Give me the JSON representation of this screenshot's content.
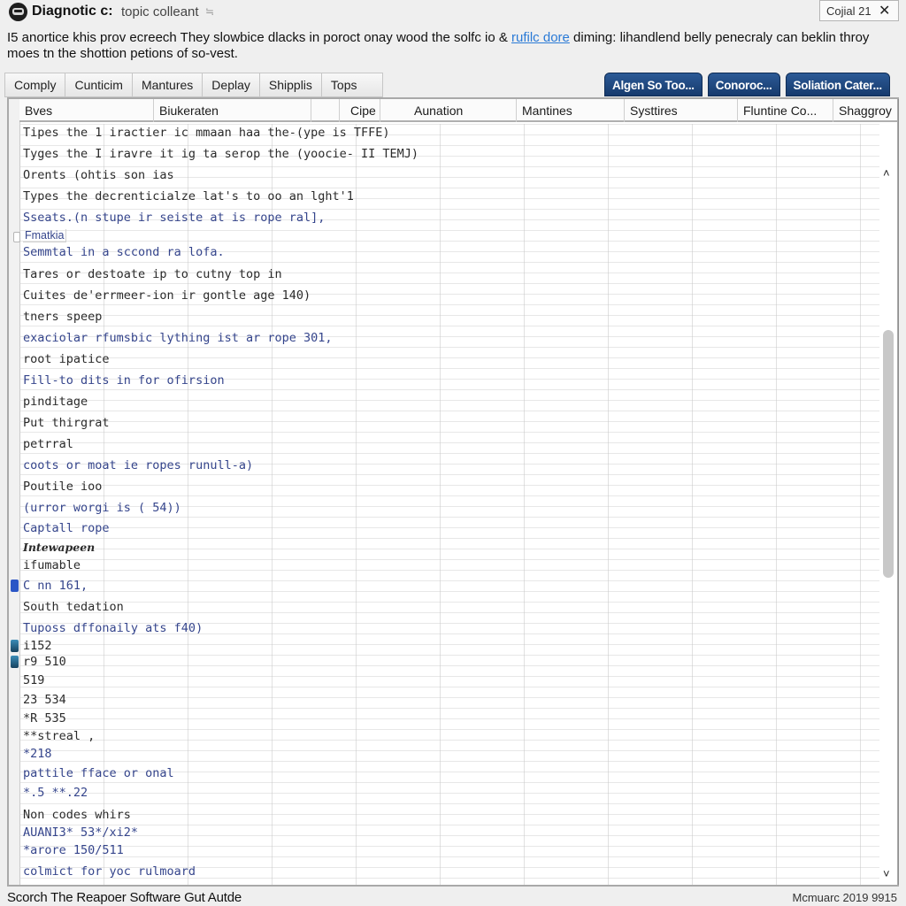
{
  "window": {
    "title": "Diagnotic c:",
    "subtitle": "topic colleant",
    "subtitle_glyph": "≒",
    "counter_label": "Cojial 21",
    "close_glyph": "✕"
  },
  "description": {
    "text_before_link": "I5 anortice khis prov ecreech They slowbice dlacks in poroct onay wood the solfc io & ",
    "link": "rufilc dore",
    "text_after_link": " diming: lihandlend belly penecraly can beklin throy moes tn the shottion petions of so-vest."
  },
  "tabs": [
    {
      "label": "Comply"
    },
    {
      "label": "Cunticim"
    },
    {
      "label": "Mantures"
    },
    {
      "label": "Deplay"
    },
    {
      "label": "Shipplis"
    },
    {
      "label": "Tops"
    }
  ],
  "blue_tabs": [
    {
      "label": "Algen So Too..."
    },
    {
      "label": "Conoroc..."
    },
    {
      "label": "Soliation Cater..."
    }
  ],
  "columns": [
    {
      "label": "Bves"
    },
    {
      "label": "Biukeraten"
    },
    {
      "label": ""
    },
    {
      "label": "Cipe"
    },
    {
      "label": "Aunation"
    },
    {
      "label": "Mantines"
    },
    {
      "label": "Systtires"
    },
    {
      "label": "Fluntine Co..."
    },
    {
      "label": "Shaggroy"
    }
  ],
  "rows": [
    {
      "text": "Tipes the 1 iractier ic mmaan haa the-(ype is TFFE)",
      "style": "dark"
    },
    {
      "text": "Tyges the I iravre it ig ta serop the (yoocie- II TEMJ)",
      "style": "dark"
    },
    {
      "text": "Orents (ohtis son ias",
      "style": "dark"
    },
    {
      "text": "Types the decrenticialze lat's to oo an lght'1",
      "style": "dark"
    },
    {
      "text": "Sseats.(n stupe ir seiste at is rope ral],",
      "style": "blue"
    },
    {
      "text": "Fmatkia",
      "style": "label",
      "indicator": "square"
    },
    {
      "text": "Semmtal in a sccond ra lofa.",
      "style": "blue"
    },
    {
      "text": "Tares or destoate ip to cutny top in",
      "style": "dark"
    },
    {
      "text": "Cuites de'errmeer-ion ir gontle age 140)",
      "style": "dark"
    },
    {
      "text": "tners speep",
      "style": "dark"
    },
    {
      "text": "exaciolar rfumsbic lything ist ar rope 301,",
      "style": "blue"
    },
    {
      "text": "root ipatice",
      "style": "dark"
    },
    {
      "text": "Fill-to dits in for ofirsion",
      "style": "blue"
    },
    {
      "text": "pinditage",
      "style": "dark"
    },
    {
      "text": "Put thirgrat",
      "style": "dark"
    },
    {
      "text": "petrral",
      "style": "dark"
    },
    {
      "text": "coots or moat ie ropes runull-a)",
      "style": "blue"
    },
    {
      "text": "Poutile ioo",
      "style": "dark"
    },
    {
      "text": "(urror worgi is ( 54))",
      "style": "blue"
    },
    {
      "text": "Captall rope",
      "style": "blue"
    },
    {
      "text": "Intewapeen",
      "style": "bold"
    },
    {
      "text": "ifumable",
      "style": "dark"
    },
    {
      "text": "C nn 161,",
      "style": "blue",
      "indicator": "blue"
    },
    {
      "text": "South tedation",
      "style": "dark"
    },
    {
      "text": "Tuposs  dffonaily ats f40)",
      "style": "blue"
    },
    {
      "text": "i152",
      "style": "dark",
      "indicator": "teal"
    },
    {
      "text": "r9 510",
      "style": "dark",
      "indicator": "teal"
    },
    {
      "text": "519",
      "style": "dark"
    },
    {
      "text": "23 534",
      "style": "dark"
    },
    {
      "text": "*R 535",
      "style": "dark"
    },
    {
      "text": "**streal ,",
      "style": "dark"
    },
    {
      "text": "*218",
      "style": "blue"
    },
    {
      "text": "pattile fface or onal",
      "style": "blue"
    },
    {
      "text": "*.5 **.22",
      "style": "blue"
    },
    {
      "text": "Non codes whirs",
      "style": "dark"
    },
    {
      "text": "AUANI3* 53*/xi2*",
      "style": "blue"
    },
    {
      "text": "*arore 150/511",
      "style": "blue"
    },
    {
      "text": "colmict for yoc rulmoard",
      "style": "blue"
    }
  ],
  "scrollbar": {
    "up_glyph": "˄",
    "down_glyph": "˅",
    "position_fraction": 0.23,
    "visible_fraction": 0.34
  },
  "status": {
    "left": "Scorch The Reapoer Software Gut Autde",
    "right": "Mcmuarc 2019 9915"
  }
}
